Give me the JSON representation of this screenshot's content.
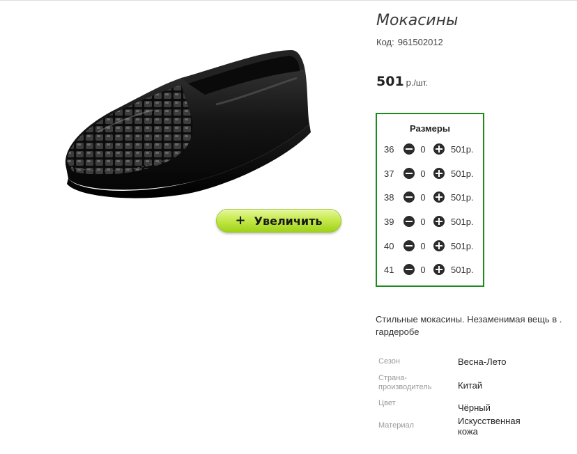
{
  "product": {
    "title": "Мокасины",
    "code_label": "Код:",
    "code": "961502012",
    "price": "501",
    "price_unit_currency": "р.",
    "price_unit_per": "/шт.",
    "zoom_plus": "+",
    "zoom_label": "Увеличить",
    "description": "Стильные мокасины. Незаменимая вещь в . гардеробе"
  },
  "sizes": {
    "title": "Размеры",
    "rows": [
      {
        "size": "36",
        "qty": "0",
        "price": "501р."
      },
      {
        "size": "37",
        "qty": "0",
        "price": "501р."
      },
      {
        "size": "38",
        "qty": "0",
        "price": "501р."
      },
      {
        "size": "39",
        "qty": "0",
        "price": "501р."
      },
      {
        "size": "40",
        "qty": "0",
        "price": "501р."
      },
      {
        "size": "41",
        "qty": "0",
        "price": "501р."
      }
    ]
  },
  "attributes": [
    {
      "label": "Сезон",
      "value": "Весна-Лето"
    },
    {
      "label": "Страна-производитель",
      "value": "Китай"
    },
    {
      "label": "Цвет",
      "value": "Чёрный"
    },
    {
      "label": "Материал",
      "value": "Искусственная кожа"
    }
  ],
  "colors": {
    "sizes_border": "#1c8a1c",
    "zoom_button": "#c6ea4e"
  },
  "icons": {
    "minus": "minus-circle-icon",
    "plus": "plus-circle-icon"
  }
}
